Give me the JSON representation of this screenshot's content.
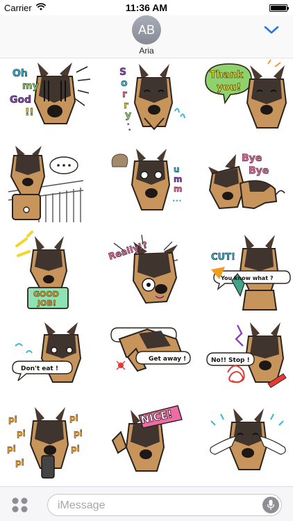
{
  "status_bar": {
    "carrier": "Carrier",
    "time": "11:36 AM"
  },
  "conversation": {
    "avatar_initials": "AB",
    "contact_name": "Aria"
  },
  "stickers": [
    {
      "id": "oh-my-god",
      "texts": [
        "Oh",
        "my",
        "God",
        "!!"
      ]
    },
    {
      "id": "sorry",
      "texts": [
        "S",
        "o",
        "r",
        "r",
        "y",
        ".",
        "."
      ]
    },
    {
      "id": "thank-you",
      "texts": [
        "Thank",
        "you!"
      ]
    },
    {
      "id": "thinking",
      "texts": []
    },
    {
      "id": "umm",
      "texts": [
        "u",
        "m",
        "m",
        "..."
      ]
    },
    {
      "id": "bye-bye",
      "texts": [
        "Bye",
        "Bye"
      ]
    },
    {
      "id": "good-job",
      "texts": [
        "GOOD",
        "JOB!"
      ]
    },
    {
      "id": "really",
      "texts": [
        "Really!?"
      ]
    },
    {
      "id": "cut",
      "texts": [
        "CUT!",
        "You know what ?"
      ]
    },
    {
      "id": "dont-eat",
      "texts": [
        "Don't eat !"
      ]
    },
    {
      "id": "get-away",
      "texts": [
        "Get away !"
      ]
    },
    {
      "id": "no-stop",
      "texts": [
        "No!! Stop !"
      ]
    },
    {
      "id": "pi-pi",
      "texts": [
        "pi",
        "pi",
        "pi",
        "pi",
        "pi",
        "pi",
        "pi"
      ]
    },
    {
      "id": "nice",
      "texts": [
        "NICE!"
      ]
    },
    {
      "id": "crying",
      "texts": []
    }
  ],
  "compose": {
    "placeholder": "iMessage"
  },
  "colors": {
    "accent_blue": "#1f7ae0",
    "dog_tan": "#c7955c",
    "dog_dark": "#3f342e",
    "sticker_red": "#e53935",
    "sticker_yellow": "#f5d626",
    "sticker_green": "#8fd26b",
    "sticker_purple": "#8a46b8",
    "sticker_cyan": "#36b7d8",
    "sticker_pink": "#f06aa4"
  },
  "icons": [
    "wifi-icon",
    "battery-icon",
    "chevron-down-icon",
    "apps-icon",
    "mic-icon"
  ]
}
